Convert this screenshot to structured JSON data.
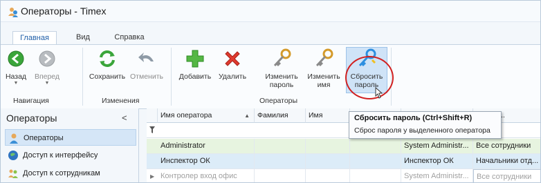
{
  "window": {
    "title": "Операторы - Timex"
  },
  "tabs": [
    {
      "label": "Главная"
    },
    {
      "label": "Вид"
    },
    {
      "label": "Справка"
    }
  ],
  "ribbon": {
    "buttons": {
      "back": {
        "label": "Назад"
      },
      "forward": {
        "label": "Вперед"
      },
      "save": {
        "label": "Сохранить"
      },
      "undo": {
        "label": "Отменить"
      },
      "add": {
        "label": "Добавить"
      },
      "delete": {
        "label": "Удалить"
      },
      "change_password": {
        "label": "Изменить пароль"
      },
      "change_name": {
        "label": "Изменить имя"
      },
      "reset_password": {
        "label": "Сбросить пароль"
      }
    },
    "groups": {
      "navigation": "Навигация",
      "changes": "Изменения",
      "operators": "Операторы"
    }
  },
  "left_panel": {
    "title": "Операторы",
    "collapse": "<",
    "items": [
      {
        "label": "Операторы",
        "icon": "user-icon",
        "selected": true
      },
      {
        "label": "Доступ к интерфейсу",
        "icon": "globe-icon"
      },
      {
        "label": "Доступ к сотрудникам",
        "icon": "users-icon"
      }
    ]
  },
  "grid": {
    "columns": [
      "Имя оператора",
      "Фамилия",
      "Имя",
      "",
      "",
      "к сотру..."
    ],
    "rows": [
      {
        "cells": [
          "Administrator",
          "",
          "",
          "",
          "System Administr...",
          "Все сотрудники"
        ]
      },
      {
        "cells": [
          "Инспектор ОК",
          "",
          "",
          "",
          "Инспектор ОК",
          "Начальники отд..."
        ]
      },
      {
        "cells": [
          "Контролер вход офис",
          "",
          "",
          "",
          "System Administr...",
          "Все сотрудники"
        ]
      }
    ]
  },
  "tooltip": {
    "title": "Сбросить пароль (Ctrl+Shift+R)",
    "description": "Сброс пароля у выделенного оператора"
  },
  "colors": {
    "accent": "#1f5ea8",
    "highlight": "#cfe3f7",
    "annotation": "#d12020"
  }
}
